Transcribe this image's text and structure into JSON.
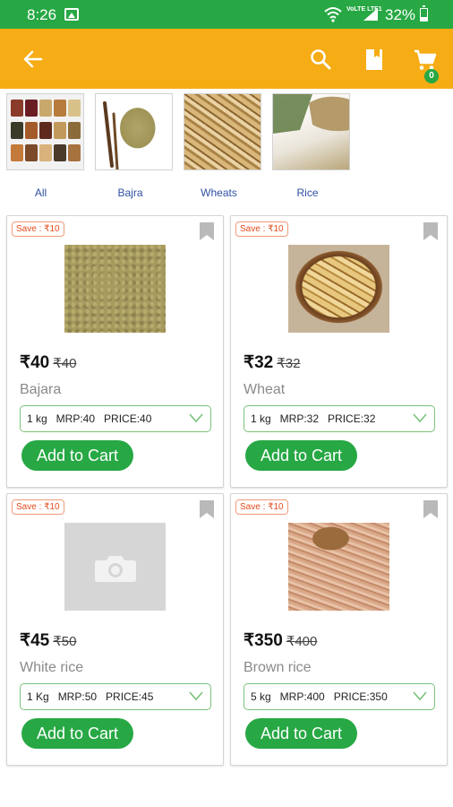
{
  "status_bar": {
    "time": "8:26",
    "battery_percent": "32%",
    "network_label": "VoLTE LTE1"
  },
  "toolbar": {
    "back_icon": "arrow-left-icon",
    "search_icon": "search-icon",
    "bookmark_icon": "bookmark-icon",
    "cart_icon": "shopping-cart-icon",
    "cart_count": "0",
    "color": "#f6ac14"
  },
  "categories": [
    {
      "label": "All"
    },
    {
      "label": "Bajra"
    },
    {
      "label": "Wheats"
    },
    {
      "label": "Rice"
    }
  ],
  "products": [
    {
      "save": "Save : ₹10",
      "price": "₹40",
      "mrp": "₹40",
      "name": "Bajara",
      "variant": "1 kg   MRP:40   PRICE:40",
      "button": "Add to Cart"
    },
    {
      "save": "Save : ₹10",
      "price": "₹32",
      "mrp": "₹32",
      "name": "Wheat",
      "variant": "1 kg   MRP:32   PRICE:32",
      "button": "Add to Cart"
    },
    {
      "save": "Save : ₹10",
      "price": "₹45",
      "mrp": "₹50",
      "name": "White rice",
      "variant": "1 Kg   MRP:50   PRICE:45",
      "button": "Add to Cart"
    },
    {
      "save": "Save : ₹10",
      "price": "₹350",
      "mrp": "₹400",
      "name": "Brown rice",
      "variant": "5 kg   MRP:400   PRICE:350",
      "button": "Add to Cart"
    }
  ],
  "colors": {
    "status_bar": "#27a844",
    "accent_green": "#27a844",
    "save_red": "#e24b1b"
  }
}
